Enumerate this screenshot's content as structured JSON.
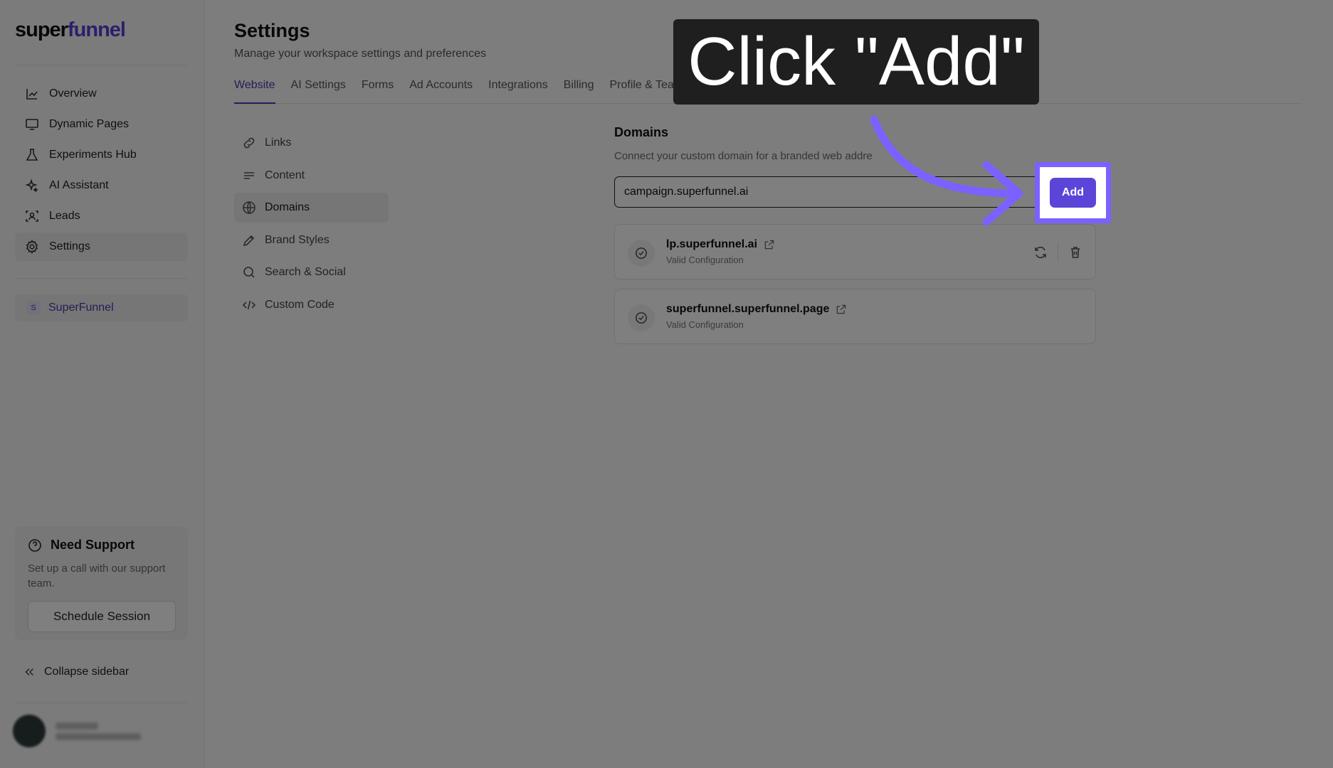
{
  "app": {
    "logo_prefix": "super",
    "logo_suffix": "funnel"
  },
  "sidebar": {
    "items": [
      {
        "label": "Overview",
        "icon": "chart-line-icon"
      },
      {
        "label": "Dynamic Pages",
        "icon": "monitor-icon"
      },
      {
        "label": "Experiments Hub",
        "icon": "flask-icon"
      },
      {
        "label": "AI Assistant",
        "icon": "sparkles-icon"
      },
      {
        "label": "Leads",
        "icon": "user-scan-icon"
      },
      {
        "label": "Settings",
        "icon": "gear-icon",
        "active": true
      }
    ],
    "workspace": {
      "badge": "S",
      "label": "SuperFunnel"
    },
    "support": {
      "title": "Need Support",
      "text": "Set up a call with our support team.",
      "button": "Schedule Session"
    },
    "collapse_label": "Collapse sidebar"
  },
  "page": {
    "title": "Settings",
    "subtitle": "Manage your workspace settings and preferences"
  },
  "tabs": [
    {
      "label": "Website",
      "active": true
    },
    {
      "label": "AI Settings"
    },
    {
      "label": "Forms"
    },
    {
      "label": "Ad Accounts"
    },
    {
      "label": "Integrations"
    },
    {
      "label": "Billing"
    },
    {
      "label": "Profile & Team"
    }
  ],
  "subnav": [
    {
      "label": "Links",
      "icon": "link-icon"
    },
    {
      "label": "Content",
      "icon": "text-lines-icon"
    },
    {
      "label": "Domains",
      "icon": "globe-icon",
      "active": true
    },
    {
      "label": "Brand Styles",
      "icon": "pen-nib-icon"
    },
    {
      "label": "Search & Social",
      "icon": "search-icon"
    },
    {
      "label": "Custom Code",
      "icon": "code-icon"
    }
  ],
  "domains": {
    "title": "Domains",
    "description": "Connect your custom domain for a branded web addre",
    "input_value": "campaign.superfunnel.ai",
    "add_label": "Add",
    "list": [
      {
        "name": "lp.superfunnel.ai",
        "status": "Valid Configuration"
      },
      {
        "name": "superfunnel.superfunnel.page",
        "status": "Valid Configuration"
      }
    ]
  },
  "callout": {
    "text": "Click \"Add\""
  },
  "colors": {
    "accent": "#5b45d9",
    "highlight": "#7b61ff",
    "callout_bg": "#1f1f1f"
  }
}
